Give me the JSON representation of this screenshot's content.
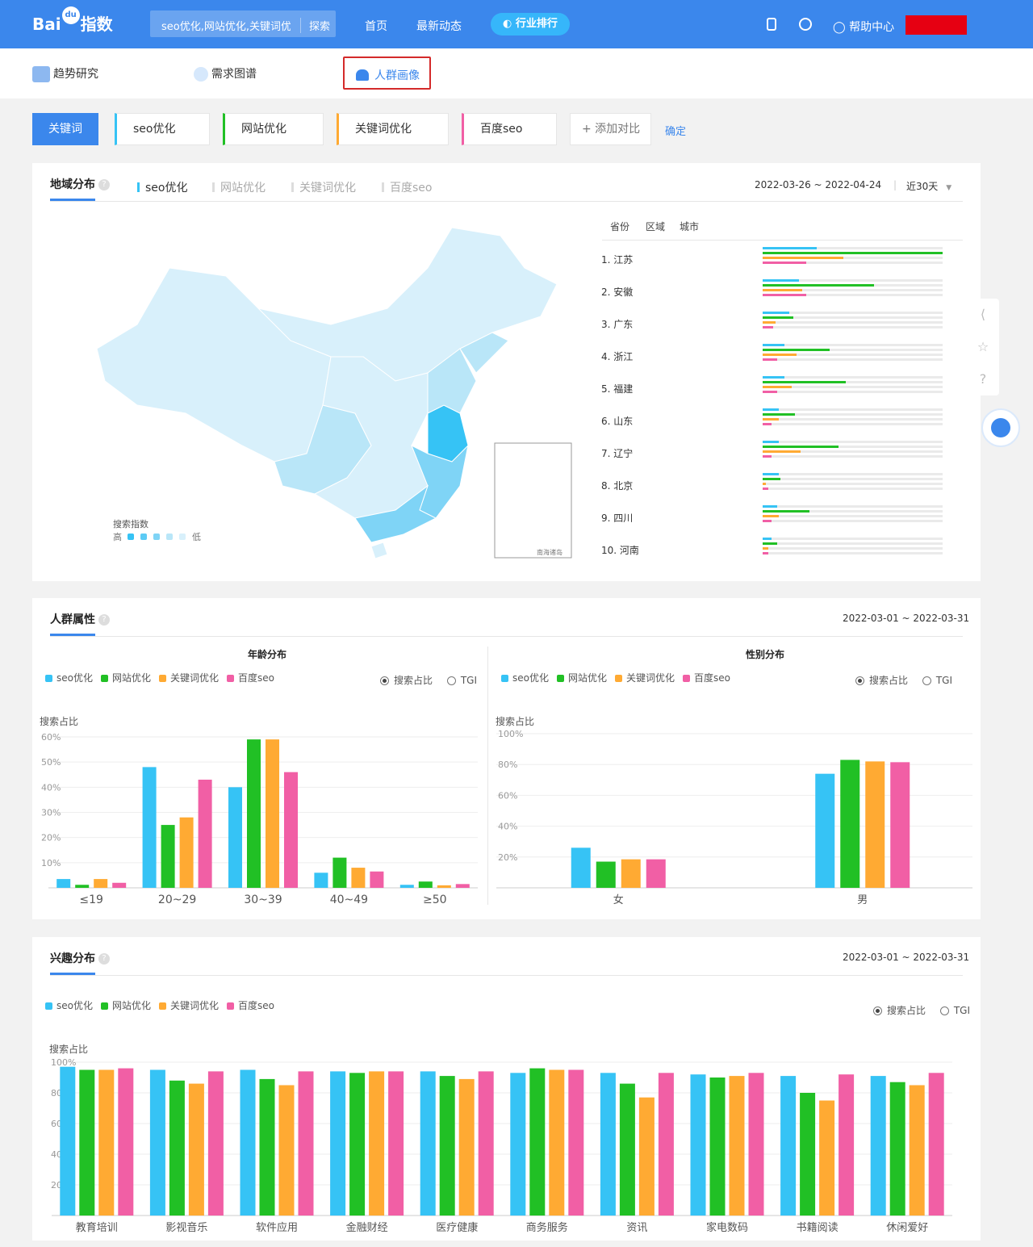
{
  "header": {
    "logo_text": "Bai",
    "logo_paw": "du",
    "logo_suffix": "指数",
    "search_value": "seo优化,网站优化,关键词优化",
    "search_button": "探索",
    "nav": [
      "首页",
      "最新动态"
    ],
    "rank_label": "行业排行",
    "help_label": "帮助中心"
  },
  "subnav": {
    "trend": "趋势研究",
    "demand": "需求图谱",
    "crowd": "人群画像"
  },
  "keywords": {
    "main": "关键词",
    "items": [
      "seo优化",
      "网站优化",
      "关键词优化",
      "百度seo"
    ],
    "colors": [
      "#36c3f5",
      "#21c025",
      "#ffaa33",
      "#f15fa5"
    ],
    "add": "+ 添加对比",
    "confirm": "确定"
  },
  "region": {
    "title": "地域分布",
    "tabs": [
      "seo优化",
      "网站优化",
      "关键词优化",
      "百度seo"
    ],
    "date_range": "2022-03-26 ~ 2022-04-24",
    "period": "近30天",
    "headers": [
      "省份",
      "区域",
      "城市"
    ],
    "map_legend_title": "搜索指数",
    "map_legend_high": "高",
    "map_legend_low": "低",
    "inset_label": "南海诸岛",
    "rows": [
      {
        "rank": "1.",
        "name": "江苏",
        "v": [
          0.3,
          1.0,
          0.45,
          0.24
        ]
      },
      {
        "rank": "2.",
        "name": "安徽",
        "v": [
          0.2,
          0.62,
          0.22,
          0.24
        ]
      },
      {
        "rank": "3.",
        "name": "广东",
        "v": [
          0.15,
          0.17,
          0.07,
          0.06
        ]
      },
      {
        "rank": "4.",
        "name": "浙江",
        "v": [
          0.12,
          0.37,
          0.19,
          0.08
        ]
      },
      {
        "rank": "5.",
        "name": "福建",
        "v": [
          0.12,
          0.46,
          0.16,
          0.08
        ]
      },
      {
        "rank": "6.",
        "name": "山东",
        "v": [
          0.09,
          0.18,
          0.09,
          0.05
        ]
      },
      {
        "rank": "7.",
        "name": "辽宁",
        "v": [
          0.09,
          0.42,
          0.21,
          0.05
        ]
      },
      {
        "rank": "8.",
        "name": "北京",
        "v": [
          0.09,
          0.1,
          0.02,
          0.03
        ]
      },
      {
        "rank": "9.",
        "name": "四川",
        "v": [
          0.08,
          0.26,
          0.09,
          0.05
        ]
      },
      {
        "rank": "10.",
        "name": "河南",
        "v": [
          0.05,
          0.08,
          0.03,
          0.03
        ]
      }
    ]
  },
  "crowd": {
    "title": "人群属性",
    "date_range": "2022-03-01 ~ 2022-03-31",
    "radio_share": "搜索占比",
    "radio_tgi": "TGI"
  },
  "interest": {
    "title": "兴趣分布",
    "date_range": "2022-03-01 ~ 2022-03-31"
  },
  "chart_data": [
    {
      "type": "bar",
      "title": "年龄分布",
      "ylabel": "搜索占比",
      "ylim": [
        0,
        60
      ],
      "yticks": [
        "10%",
        "20%",
        "30%",
        "40%",
        "50%",
        "60%"
      ],
      "categories": [
        "≤19",
        "20~29",
        "30~39",
        "40~49",
        "≥50"
      ],
      "series": [
        {
          "name": "seo优化",
          "values": [
            3.5,
            48,
            40,
            6,
            1.2
          ]
        },
        {
          "name": "网站优化",
          "values": [
            1.2,
            25,
            59,
            12,
            2.5
          ]
        },
        {
          "name": "关键词优化",
          "values": [
            3.5,
            28,
            59,
            8,
            1
          ]
        },
        {
          "name": "百度seo",
          "values": [
            2,
            43,
            46,
            6.5,
            1.5
          ]
        }
      ]
    },
    {
      "type": "bar",
      "title": "性别分布",
      "ylabel": "搜索占比",
      "ylim": [
        0,
        100
      ],
      "yticks": [
        "20%",
        "40%",
        "60%",
        "80%",
        "100%"
      ],
      "categories": [
        "女",
        "男"
      ],
      "series": [
        {
          "name": "seo优化",
          "values": [
            26,
            74
          ]
        },
        {
          "name": "网站优化",
          "values": [
            17,
            83
          ]
        },
        {
          "name": "关键词优化",
          "values": [
            18.5,
            82
          ]
        },
        {
          "name": "百度seo",
          "values": [
            18.5,
            81.5
          ]
        }
      ]
    },
    {
      "type": "bar",
      "title": "",
      "ylabel": "搜索占比",
      "ylim": [
        0,
        100
      ],
      "yticks": [
        "20",
        "40",
        "60",
        "80",
        "100%"
      ],
      "categories": [
        "教育培训",
        "影视音乐",
        "软件应用",
        "金融财经",
        "医疗健康",
        "商务服务",
        "资讯",
        "家电数码",
        "书籍阅读",
        "休闲爱好"
      ],
      "series": [
        {
          "name": "seo优化",
          "values": [
            97,
            95,
            95,
            94,
            94,
            93,
            93,
            92,
            91,
            91
          ]
        },
        {
          "name": "网站优化",
          "values": [
            95,
            88,
            89,
            93,
            91,
            96,
            86,
            90,
            80,
            87
          ]
        },
        {
          "name": "关键词优化",
          "values": [
            95,
            86,
            85,
            94,
            89,
            95,
            77,
            91,
            75,
            85
          ]
        },
        {
          "name": "百度seo",
          "values": [
            96,
            94,
            94,
            94,
            94,
            95,
            93,
            93,
            92,
            93
          ]
        }
      ]
    }
  ]
}
